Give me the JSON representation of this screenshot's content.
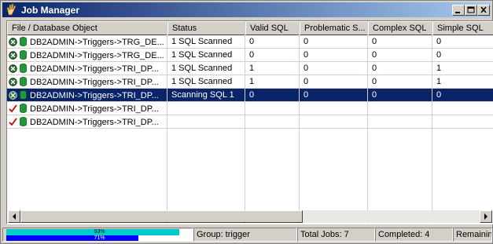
{
  "window": {
    "title": "Job Manager"
  },
  "title_buttons": [
    {
      "name": "minimize-button",
      "icon": "minimize-icon"
    },
    {
      "name": "maximize-button",
      "icon": "maximize-icon"
    },
    {
      "name": "close-button",
      "icon": "close-icon"
    }
  ],
  "columns": [
    "File / Database Object",
    "Status",
    "Valid SQL",
    "Problematic S...",
    "Complex SQL",
    "Simple SQL"
  ],
  "rows": [
    {
      "state": "done",
      "object": "DB2ADMIN->Triggers->TRG_DE...",
      "status": "1 SQL Scanned",
      "valid": "0",
      "problematic": "0",
      "complex": "0",
      "simple": "0"
    },
    {
      "state": "done",
      "object": "DB2ADMIN->Triggers->TRG_DE...",
      "status": "1 SQL Scanned",
      "valid": "0",
      "problematic": "0",
      "complex": "0",
      "simple": "0"
    },
    {
      "state": "done",
      "object": "DB2ADMIN->Triggers->TRI_DP...",
      "status": "1 SQL Scanned",
      "valid": "1",
      "problematic": "0",
      "complex": "0",
      "simple": "1"
    },
    {
      "state": "done",
      "object": "DB2ADMIN->Triggers->TRI_DP...",
      "status": "1 SQL Scanned",
      "valid": "1",
      "problematic": "0",
      "complex": "0",
      "simple": "1"
    },
    {
      "state": "running",
      "selected": true,
      "object": "DB2ADMIN->Triggers->TRI_DP...",
      "status": "Scanning SQL 1",
      "valid": "0",
      "problematic": "0",
      "complex": "0",
      "simple": "0"
    },
    {
      "state": "queued",
      "object": "DB2ADMIN->Triggers->TRI_DP...",
      "status": "",
      "valid": "",
      "problematic": "",
      "complex": "",
      "simple": ""
    },
    {
      "state": "queued",
      "object": "DB2ADMIN->Triggers->TRI_DP...",
      "status": "",
      "valid": "",
      "problematic": "",
      "complex": "",
      "simple": ""
    }
  ],
  "status_bar": {
    "progress_top": {
      "label": "93%",
      "value": 93
    },
    "progress_bottom": {
      "label": "71%",
      "value": 71
    },
    "group": "Group: trigger",
    "total": "Total Jobs: 7",
    "completed": "Completed: 4",
    "remaining": "Remaining"
  },
  "colors": {
    "selection": "#0a246a",
    "progress_top": "#00cccc",
    "progress_bottom": "#0000ff",
    "done_icon": "#2a7d2a",
    "queued_icon": "#cc0000"
  }
}
